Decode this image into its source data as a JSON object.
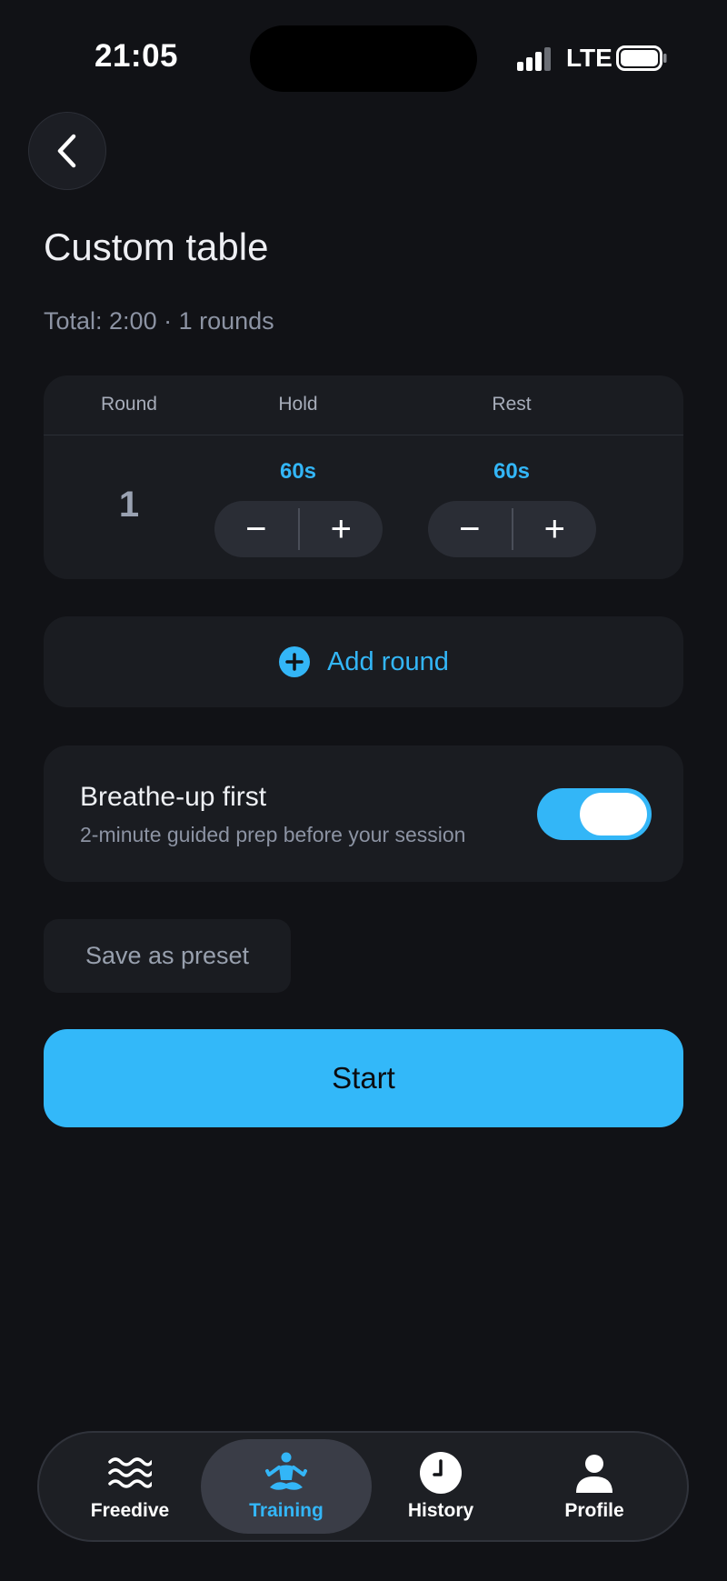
{
  "status_bar": {
    "time": "21:05",
    "network": "LTE",
    "signal_icon": "signal-bars-icon",
    "battery_icon": "battery-full-icon"
  },
  "header": {
    "back_icon": "chevron-left-icon",
    "title": "Custom table",
    "summary": "Total: 2:00 · 1 rounds"
  },
  "table": {
    "columns": [
      "Round",
      "Hold",
      "Rest"
    ],
    "rows": [
      {
        "round": "1",
        "hold": "60s",
        "rest": "60s"
      }
    ],
    "decrement_label": "−",
    "increment_label": "+"
  },
  "add_round": {
    "icon": "plus-circle-icon",
    "label": "Add round"
  },
  "breathe_up": {
    "title": "Breathe-up first",
    "description": "2-minute guided prep before your session",
    "enabled": true
  },
  "save_preset_label": "Save as preset",
  "start_label": "Start",
  "nav": {
    "items": [
      {
        "label": "Freedive",
        "icon": "waves-icon",
        "active": false
      },
      {
        "label": "Training",
        "icon": "meditation-icon",
        "active": true
      },
      {
        "label": "History",
        "icon": "clock-icon",
        "active": false
      },
      {
        "label": "Profile",
        "icon": "person-icon",
        "active": false
      }
    ]
  },
  "colors": {
    "background": "#111216",
    "card": "#1a1c21",
    "accent": "#33b6f7",
    "muted_text": "#8c93a3"
  }
}
